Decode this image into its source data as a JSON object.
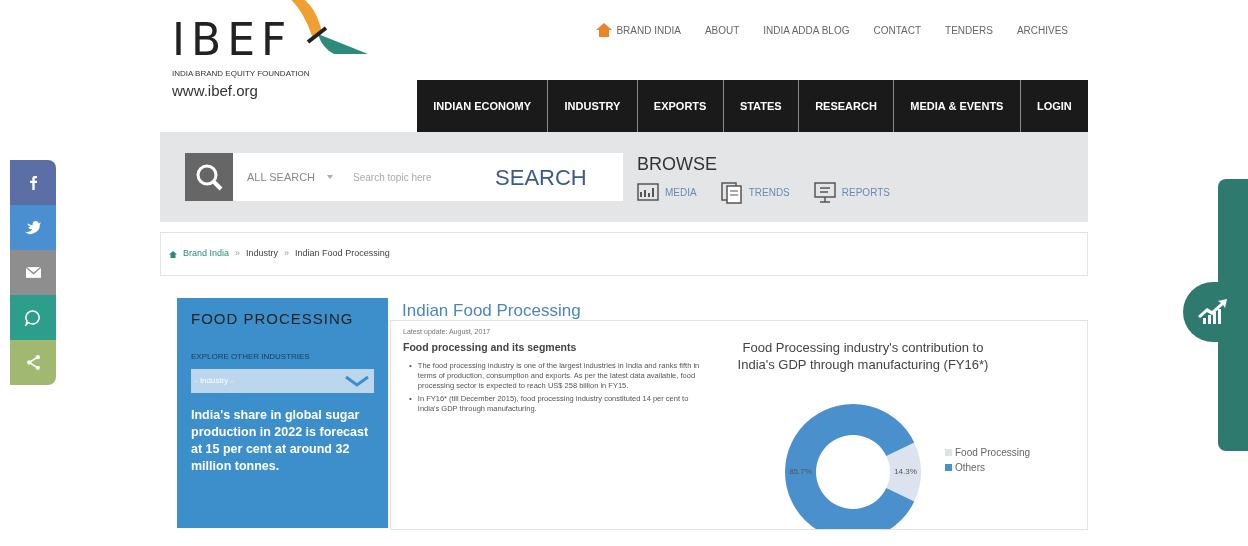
{
  "logo": {
    "wordmark": "IBEF",
    "tagline": "INDIA BRAND EQUITY FOUNDATION",
    "url": "www.ibef.org"
  },
  "top_links": [
    "BRAND INDIA",
    "ABOUT",
    "INDIA ADDA BLOG",
    "CONTACT",
    "TENDERS",
    "ARCHIVES"
  ],
  "main_nav": [
    "INDIAN ECONOMY",
    "INDUSTRY",
    "EXPORTS",
    "STATES",
    "RESEARCH",
    "MEDIA & EVENTS",
    "LOGIN"
  ],
  "search": {
    "scope": "ALL SEARCH",
    "placeholder": "Search topic here",
    "button": "SEARCH"
  },
  "browse": {
    "title": "BROWSE",
    "links": [
      {
        "kind": "media",
        "label": "MEDIA"
      },
      {
        "kind": "trends",
        "label": "TRENDS"
      },
      {
        "kind": "reports",
        "label": "REPORTS"
      }
    ]
  },
  "breadcrumb": [
    {
      "kind": "link",
      "text": "Brand India"
    },
    {
      "kind": "separator",
      "text": "»"
    },
    {
      "kind": "link",
      "text": "Industry"
    },
    {
      "kind": "separator",
      "text": "»"
    },
    {
      "kind": "current",
      "text": "Indian Food Processing"
    }
  ],
  "share_bar": [
    {
      "kind": "facebook",
      "color": "#5b6fa6"
    },
    {
      "kind": "twitter",
      "color": "#4a90d0"
    },
    {
      "kind": "email",
      "color": "#8e8e8e"
    },
    {
      "kind": "whatsapp",
      "color": "#2e9e8c"
    },
    {
      "kind": "share",
      "color": "#a0b870"
    }
  ],
  "sidebar": {
    "title": "FOOD PROCESSING",
    "explore_label": "EXPLORE OTHER INDUSTRIES",
    "dropdown": "- Industry -",
    "fact": "India's share in global sugar production in 2022 is forecast at 15 per cent at around 32 million tonnes."
  },
  "article": {
    "title": "Indian Food Processing",
    "updated": "Latest update: August, 2017",
    "heading": "Food processing and its segments",
    "bullets": [
      {
        "marker": "•",
        "text": "The food processing industry is one of the largest industries in India and ranks fifth in terms of production, consumption and exports. As per the latest data available, food processing sector is expected to reach US$ 258 billion in FY15."
      },
      {
        "marker": "•",
        "text": "In FY16* (till December 2015), food processing industry constituted 14 per cent to India's GDP through manufacturing."
      }
    ],
    "chart_data": {
      "type": "donut",
      "title": "Food Processing industry's contribution to India's GDP through manufacturing (FY16*)",
      "categories": [
        "Food Processing",
        "Others"
      ],
      "values": [
        14.3,
        85.7
      ],
      "colors": [
        "#dde3ee",
        "#4a90cc"
      ],
      "value_labels": [
        "14.3%",
        "85.7%"
      ],
      "legend": "right"
    }
  }
}
